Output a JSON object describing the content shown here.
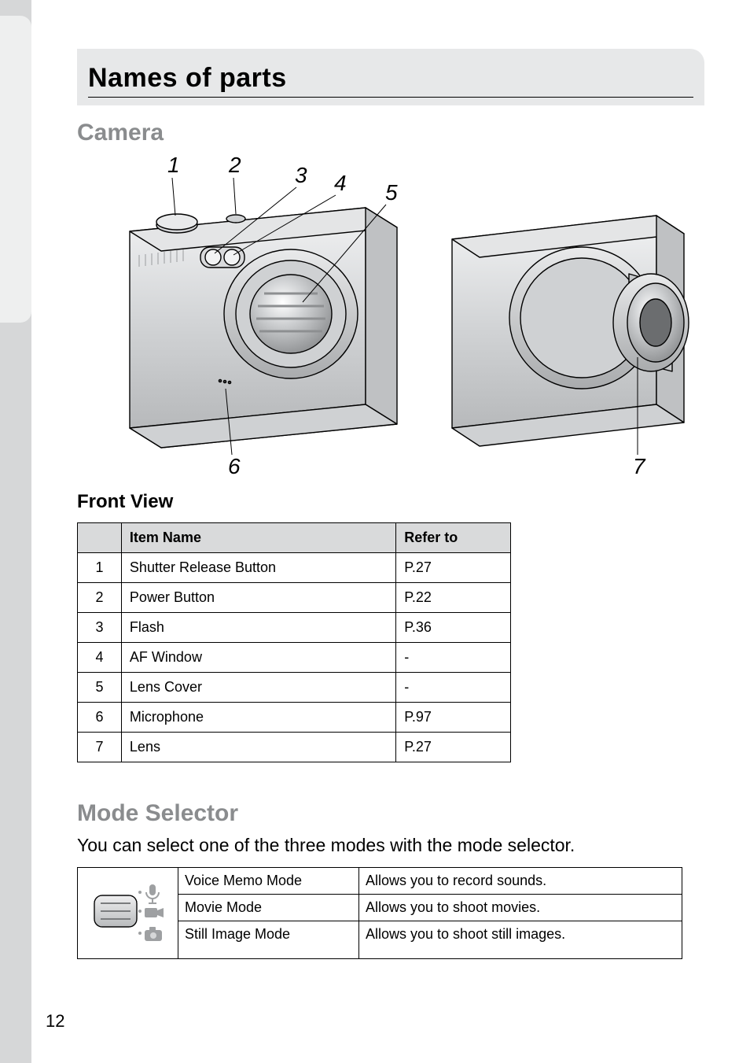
{
  "page_number": "12",
  "heading": "Names of parts",
  "camera_section_title": "Camera",
  "front_view_heading": "Front View",
  "diagram_labels": [
    "1",
    "2",
    "3",
    "4",
    "5",
    "6",
    "7"
  ],
  "front_view_table": {
    "headers": {
      "num": "",
      "item": "Item Name",
      "ref": "Refer to"
    },
    "rows": [
      {
        "num": "1",
        "item": "Shutter Release Button",
        "ref": "P.27"
      },
      {
        "num": "2",
        "item": "Power Button",
        "ref": "P.22"
      },
      {
        "num": "3",
        "item": "Flash",
        "ref": "P.36"
      },
      {
        "num": "4",
        "item": "AF Window",
        "ref": "-"
      },
      {
        "num": "5",
        "item": "Lens Cover",
        "ref": "-"
      },
      {
        "num": "6",
        "item": "Microphone",
        "ref": "P.97"
      },
      {
        "num": "7",
        "item": "Lens",
        "ref": "P.27"
      }
    ]
  },
  "mode_selector_title": "Mode Selector",
  "mode_selector_desc": "You can select one of the three modes with the mode selector.",
  "mode_selector_table": {
    "rows": [
      {
        "mode": "Voice Memo Mode",
        "desc": "Allows you to record sounds."
      },
      {
        "mode": "Movie Mode",
        "desc": "Allows you to shoot movies."
      },
      {
        "mode": "Still Image Mode",
        "desc": "Allows you to shoot still images."
      }
    ]
  }
}
